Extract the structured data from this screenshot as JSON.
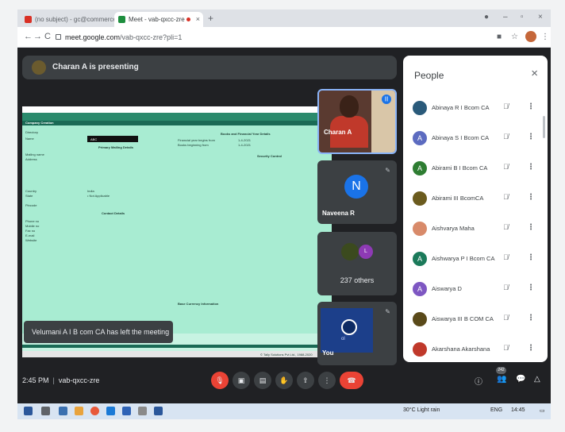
{
  "browser": {
    "tabs": [
      {
        "label": "(no subject) - gc@commercecal"
      },
      {
        "label": "Meet - vab-qxcc-zre"
      }
    ],
    "url_host": "meet.google.com",
    "url_path": "/vab-qxcc-zre?pli=1"
  },
  "meet": {
    "presenting_banner": "Charan A is presenting",
    "toast": "Velumani A I B com CA has left the meeting",
    "tiles": {
      "charan": "Charan A",
      "naveena": "Naveena R",
      "naveena_initial": "N",
      "others_count": "237 others",
      "others_initial": "L",
      "you": "You",
      "you_small": "ol"
    },
    "time": "2:45 PM",
    "meeting_code": "vab-qxcc-zre",
    "participant_badge": "242"
  },
  "tally": {
    "company_creation": "Company Creation",
    "directory": "Directory",
    "name": "Name",
    "name_value": "ABC",
    "primary_mailing": "Primary Mailing Details",
    "mailing_name": "Mailing name",
    "address": "Address",
    "country": "Country",
    "country_value": "India",
    "state": "State",
    "state_value": "• Not Applicable",
    "pincode": "Pincode",
    "contact_details": "Contact Details",
    "phone": "Phone no",
    "mobile": "Mobile no",
    "fax": "Fax no",
    "email": "E-mail",
    "website": "Website",
    "books_fy": "Books and Financial Year Details",
    "fy_begins": "Financial year begins from",
    "fy_value": "1-4-2021",
    "books_begin": "Books beginning from",
    "books_value": "1-4-2021",
    "security_control": "Security Control",
    "base_currency": "Base Currency Information",
    "footer": "© Tally Solutions Pvt Ltd., 1988-2020"
  },
  "people": {
    "title": "People",
    "participants": [
      {
        "name": "Abinaya R I Bcom CA",
        "initial": "",
        "color": "#2a5a7a"
      },
      {
        "name": "Abinaya S I Bcom CA",
        "initial": "A",
        "color": "#5c6bc0"
      },
      {
        "name": "Abirami B I Bcom CA",
        "initial": "A",
        "color": "#2e7d32"
      },
      {
        "name": "Abirami III BcomCA",
        "initial": "",
        "color": "#6b5b1e"
      },
      {
        "name": "Aishvarya Maha",
        "initial": "",
        "color": "#d88a6a"
      },
      {
        "name": "Aishwarya P I Bcom CA",
        "initial": "A",
        "color": "#1b7a5a"
      },
      {
        "name": "Aiswarya D",
        "initial": "A",
        "color": "#7e57c2"
      },
      {
        "name": "Aiswarya III B COM CA",
        "initial": "",
        "color": "#5a4a1a"
      },
      {
        "name": "Akarshana Akarshana",
        "initial": "",
        "color": "#c0392b"
      }
    ]
  },
  "taskbar": {
    "weather": "30°C Light rain",
    "lang": "ENG",
    "clock": "14:45"
  }
}
